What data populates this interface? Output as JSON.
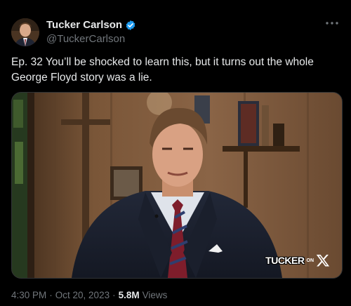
{
  "author": {
    "display_name": "Tucker Carlson",
    "handle": "@TuckerCarlson",
    "verified": true
  },
  "tweet": {
    "text_line1": "Ep. 32  You’ll be shocked to learn this, but it turns out the whole",
    "text_line2": "George Floyd story was a lie."
  },
  "media": {
    "watermark_main": "TUCKER",
    "watermark_small": "ON",
    "watermark_icon": "x-logo-icon"
  },
  "meta": {
    "time": "4:30 PM",
    "separator": "·",
    "date": "Oct 20, 2023",
    "views_count": "5.8M",
    "views_label": "Views"
  },
  "colors": {
    "background": "#000000",
    "text_primary": "#e7e9ea",
    "text_secondary": "#71767b",
    "verified_blue": "#1d9bf0"
  },
  "icons": {
    "verified": "verified-badge-icon",
    "more": "more-horizontal-icon"
  }
}
